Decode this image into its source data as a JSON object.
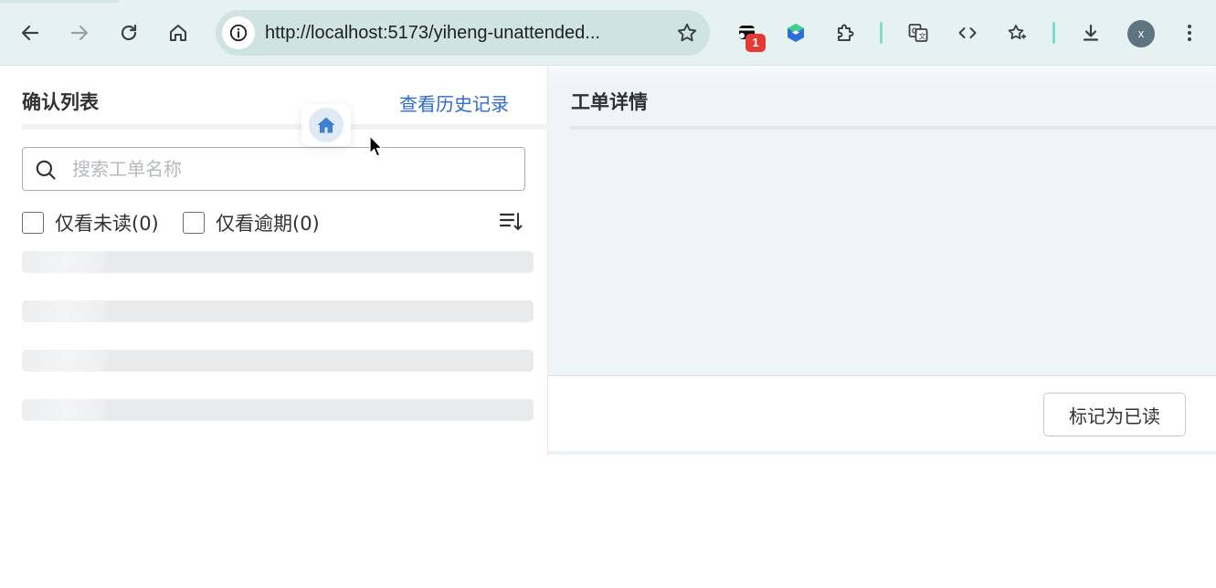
{
  "browser": {
    "url": "http://localhost:5173/yiheng-unattended...",
    "extension_badge": "1",
    "profile_initial": "x",
    "icons": [
      "back-icon",
      "forward-icon",
      "reload-icon",
      "home-icon",
      "site-info-icon",
      "bookmark-star-icon",
      "extension-badge-icon",
      "gem-extension-icon",
      "puzzle-icon",
      "translate-icon",
      "code-icon",
      "favorites-icon",
      "download-icon",
      "more-icon"
    ]
  },
  "left": {
    "title": "确认列表",
    "history_link": "查看历史记录",
    "search_placeholder": "搜索工单名称",
    "filters": [
      {
        "label": "仅看未读(0)",
        "checked": false
      },
      {
        "label": "仅看逾期(0)",
        "checked": false
      }
    ],
    "skeleton_rows": 4
  },
  "right": {
    "title": "工单详情",
    "mark_read_button": "标记为已读"
  },
  "colors": {
    "accent_link": "#2f6bd0",
    "toolbar_bg": "#e6f2f1",
    "detail_bg": "#eef4f7"
  }
}
